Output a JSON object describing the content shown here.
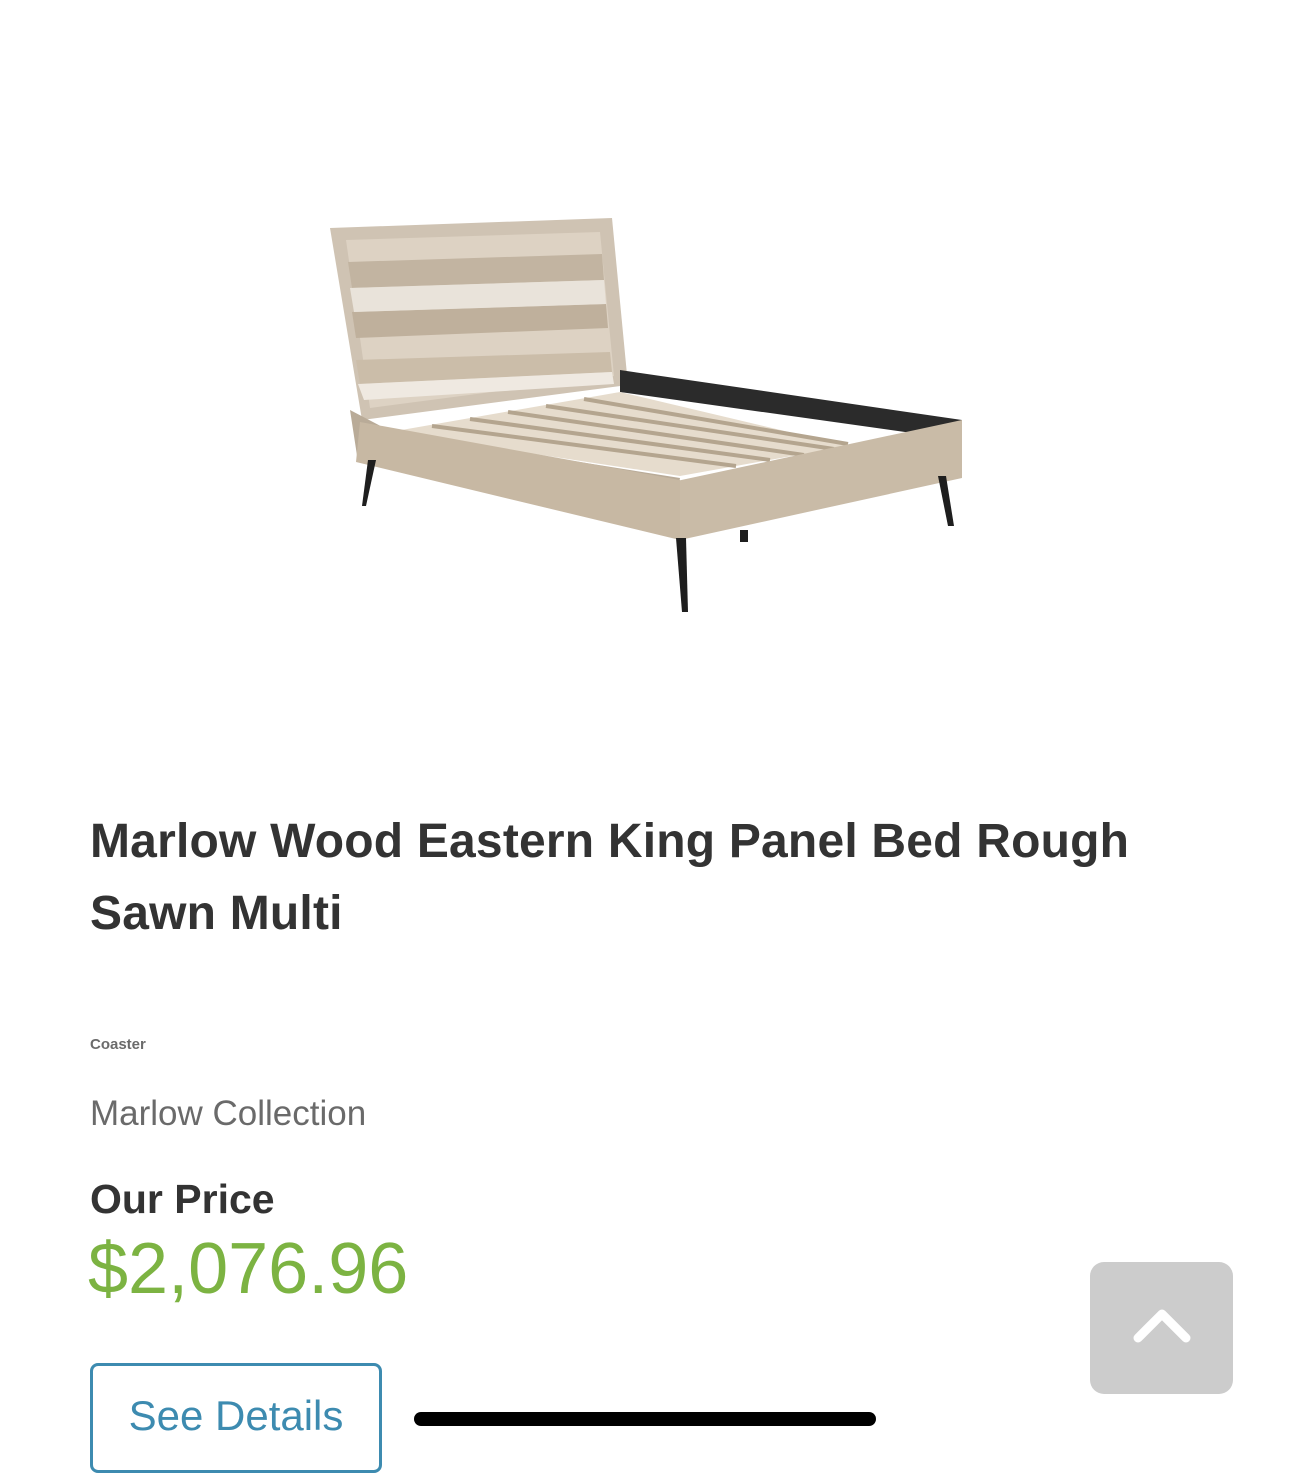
{
  "product": {
    "title": "Marlow Wood Eastern King Panel Bed Rough Sawn Multi",
    "brand": "Coaster",
    "collection": "Marlow Collection",
    "price_label": "Our Price",
    "price": "$2,076.96",
    "image_subject": "Marlow wood panel bed with black metal legs",
    "details_button": "See Details"
  },
  "controls": {
    "scroll_top_icon": "chevron-up-icon"
  },
  "colors": {
    "price": "#7cb342",
    "button_accent": "#3d8bb0",
    "scroll_button_bg": "#cccccc",
    "title_text": "#333333"
  }
}
